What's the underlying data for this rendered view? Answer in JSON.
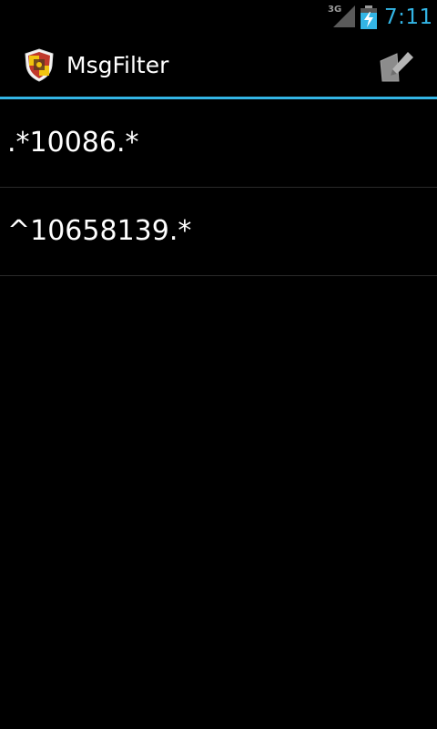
{
  "status_bar": {
    "network_type": "3G",
    "time": "7:11",
    "clock_color": "#33b5e5"
  },
  "action_bar": {
    "app_icon": "shield-icon",
    "title": "MsgFilter",
    "compose_icon": "compose-icon",
    "accent_color": "#33b5e5"
  },
  "filters": [
    {
      "pattern": ".*10086.*"
    },
    {
      "pattern": "^10658139.*"
    }
  ]
}
